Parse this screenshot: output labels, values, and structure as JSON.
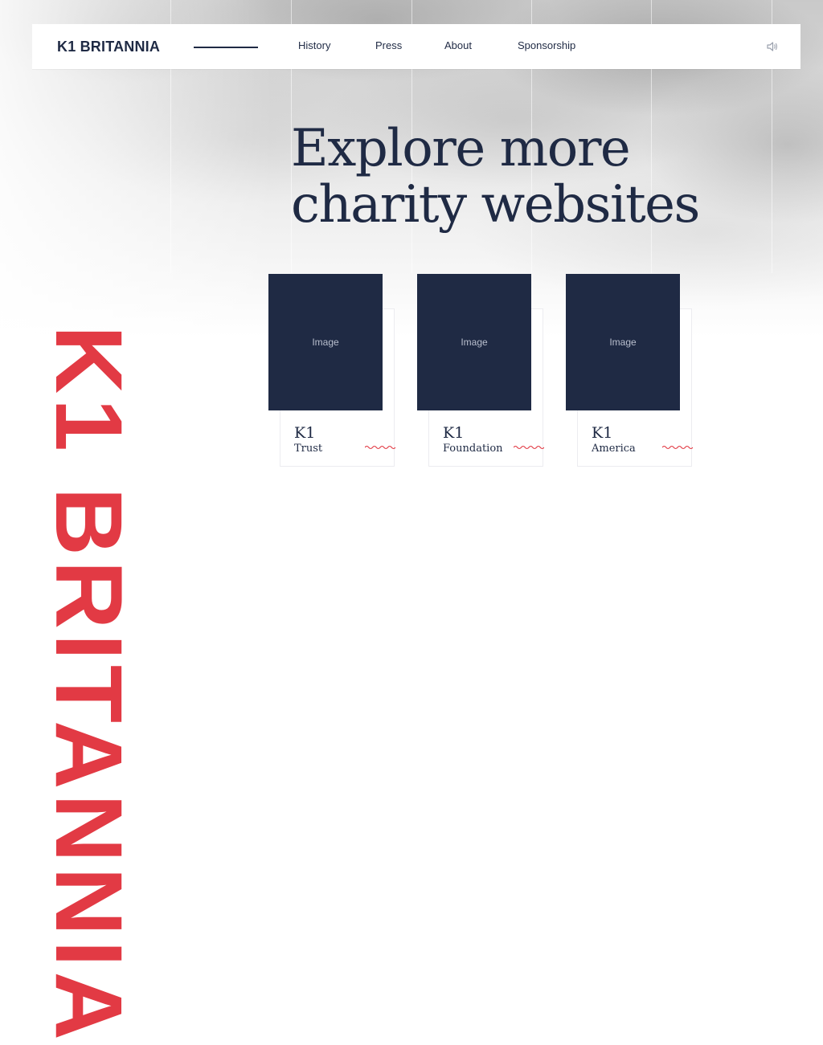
{
  "brand": {
    "name": "K1 BRITANNIA"
  },
  "nav": {
    "items": [
      {
        "label": "History"
      },
      {
        "label": "Press"
      },
      {
        "label": "About"
      },
      {
        "label": "Sponsorship"
      }
    ],
    "sound_icon": "speaker-icon"
  },
  "hero": {
    "line1": "Explore more",
    "line2": "charity websites"
  },
  "side_text": "K1 BRITANNIA",
  "cards": [
    {
      "image_label": "Image",
      "k1": "K1",
      "name": "Trust"
    },
    {
      "image_label": "Image",
      "k1": "K1",
      "name": "Foundation"
    },
    {
      "image_label": "Image",
      "k1": "K1",
      "name": "America"
    }
  ],
  "colors": {
    "navy": "#1f2a44",
    "accent_red": "#e23a44"
  }
}
